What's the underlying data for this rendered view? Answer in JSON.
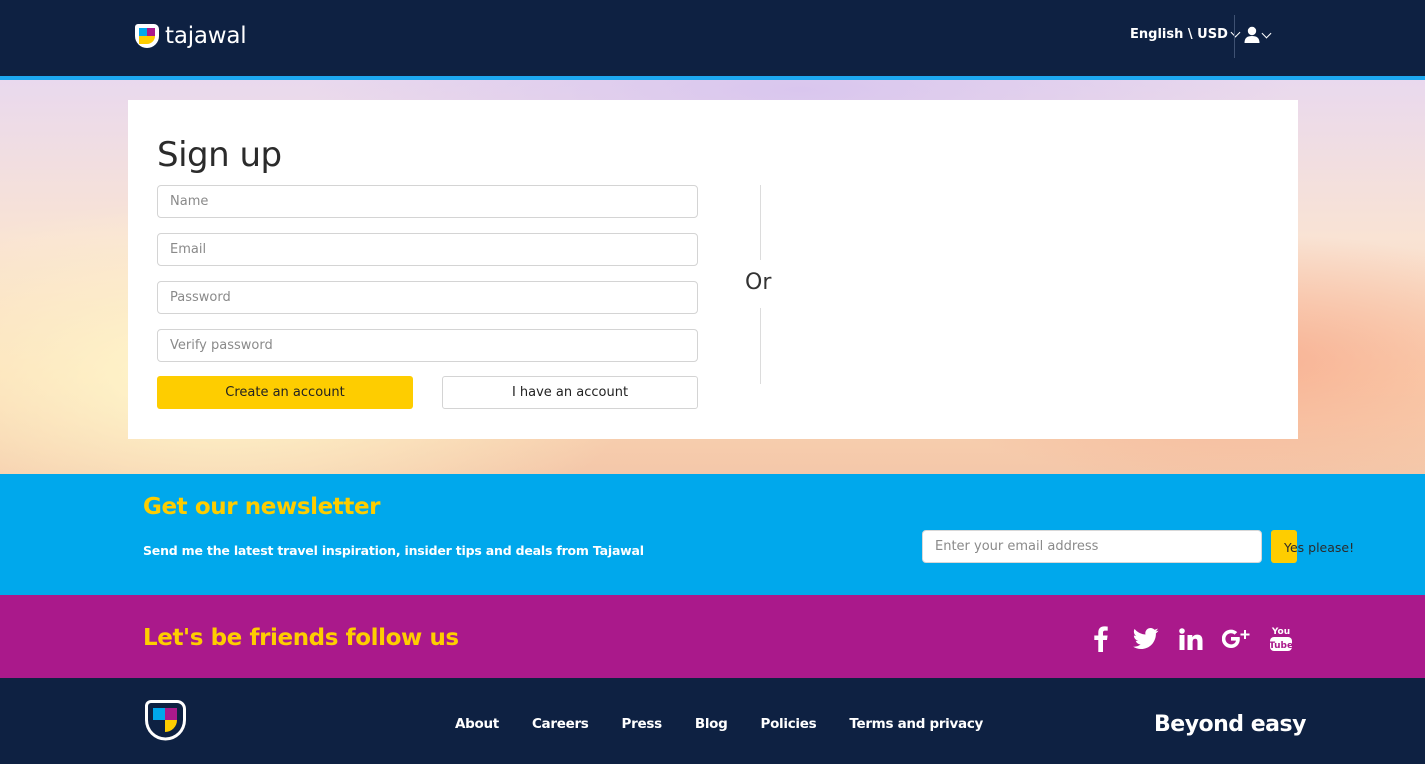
{
  "header": {
    "logo_text": "tajawal",
    "language_currency": "English \\ USD"
  },
  "signup": {
    "title": "Sign up",
    "name_placeholder": "Name",
    "email_placeholder": "Email",
    "password_placeholder": "Password",
    "verify_password_placeholder": "Verify password",
    "create_account_label": "Create an account",
    "have_account_label": "I have an account",
    "or_label": "Or"
  },
  "newsletter": {
    "title": "Get our newsletter",
    "subtitle_prefix": "Send me the latest travel inspiration, insider tips and deals from ",
    "subtitle_brand": "Tajawal",
    "email_placeholder": "Enter your email address",
    "submit_label": "Yes please!"
  },
  "social": {
    "title": "Let's be friends follow us",
    "icons": [
      "facebook-icon",
      "twitter-icon",
      "linkedin-icon",
      "google-plus-icon",
      "youtube-icon"
    ]
  },
  "footer": {
    "links": [
      "About",
      "Careers",
      "Press",
      "Blog",
      "Policies",
      "Terms and privacy"
    ],
    "tagline": "Beyond easy"
  },
  "colors": {
    "navy": "#0e2142",
    "accent_blue": "#1da8f0",
    "newsletter_bg": "#00a8ec",
    "social_bg": "#aa198b",
    "yellow": "#fecd00"
  }
}
